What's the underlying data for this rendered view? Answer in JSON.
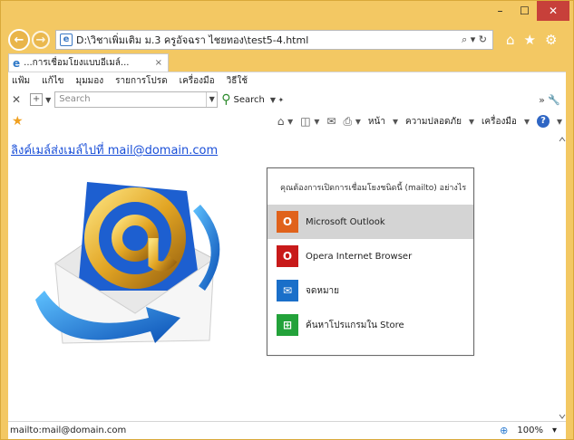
{
  "window": {
    "minimize": "–",
    "maximize": "☐",
    "close": "✕"
  },
  "address_bar": {
    "url": "D:\\วิชาเพิ่มเติม ม.3 ครูอัจฉรา ไชยทอง\\test5-4.html",
    "search_glyph": "⌕ ▾ ↻"
  },
  "tab": {
    "title": "...การเชื่อมโยงแบบอีเมล์...",
    "close": "×"
  },
  "menubar": [
    "แฟ้ม",
    "แก้ไข",
    "มุมมอง",
    "รายการโปรด",
    "เครื่องมือ",
    "วิธีใช้"
  ],
  "search_toolbar": {
    "placeholder": "Search",
    "button_label": "Search"
  },
  "command_bar": {
    "page": "หน้า",
    "safety": "ความปลอดภัย",
    "tools": "เครื่องมือ"
  },
  "content": {
    "link_text": "ลิงค์เมล์ส่งเมล์ไปที่ mail@domain.com"
  },
  "popup": {
    "title": "คุณต้องการเปิดการเชื่อมโยงชนิดนี้ (mailto) อย่างไร",
    "items": [
      {
        "label": "Microsoft Outlook",
        "icon": "outlook-icon",
        "color": "#e0621b",
        "selected": true
      },
      {
        "label": "Opera Internet Browser",
        "icon": "opera-icon",
        "color": "#c81a1a",
        "selected": false
      },
      {
        "label": "จดหมาย",
        "icon": "mail-icon",
        "color": "#1a6fc9",
        "selected": false
      },
      {
        "label": "ค้นหาโปรแกรมใน Store",
        "icon": "store-icon",
        "color": "#23a23a",
        "selected": false
      }
    ]
  },
  "statusbar": {
    "text": "mailto:mail@domain.com",
    "zoom": "100%"
  },
  "colors": {
    "frame": "#f3c863",
    "link": "#1a4fd8",
    "close": "#c7403a"
  }
}
